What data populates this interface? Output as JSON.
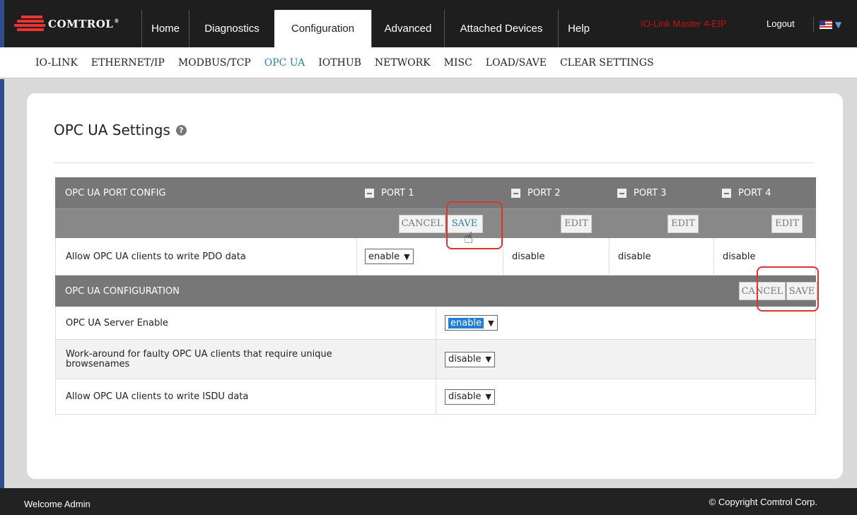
{
  "header": {
    "logo_text": "COMTROL",
    "logo_reg": "®",
    "nav": [
      "Home",
      "Diagnostics",
      "Configuration",
      "Advanced",
      "Attached Devices",
      "Help"
    ],
    "active_nav": "Configuration",
    "device_name": "IO-Link Master 4-EIP",
    "logout": "Logout"
  },
  "subnav": {
    "items": [
      "IO-LINK",
      "ETHERNET/IP",
      "MODBUS/TCP",
      "OPC UA",
      "IOTHUB",
      "NETWORK",
      "MISC",
      "LOAD/SAVE",
      "CLEAR SETTINGS"
    ],
    "active": "OPC UA"
  },
  "page": {
    "title": "OPC UA Settings",
    "help_icon": "?"
  },
  "port_config": {
    "header": "OPC UA PORT CONFIG",
    "ports": [
      "PORT 1",
      "PORT 2",
      "PORT 3",
      "PORT 4"
    ],
    "cancel": "CANCEL",
    "save": "SAVE",
    "edit": "EDIT",
    "row_label": "Allow OPC UA clients to write PDO data",
    "port1_value": "enable",
    "port2_value": "disable",
    "port3_value": "disable",
    "port4_value": "disable"
  },
  "opcua_config": {
    "header": "OPC UA CONFIGURATION",
    "cancel": "CANCEL",
    "save": "SAVE",
    "rows": [
      {
        "label": "OPC UA Server Enable",
        "value": "enable"
      },
      {
        "label": "Work-around for faulty OPC UA clients that require unique browsenames",
        "value": "disable"
      },
      {
        "label": "Allow OPC UA clients to write ISDU data",
        "value": "disable"
      }
    ]
  },
  "footer": {
    "welcome": "Welcome Admin",
    "copyright": "© Copyright Comtrol Corp."
  },
  "colors": {
    "accent_blue": "#2a7fb0",
    "header_gray": "#777777",
    "annotation_red": "#dd3333",
    "device_red": "#cc1111"
  }
}
